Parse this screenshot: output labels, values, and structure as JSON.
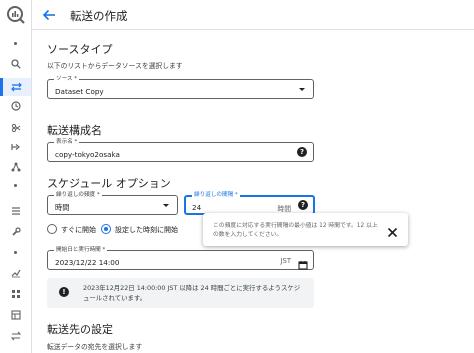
{
  "colors": {
    "accent": "#1a73e8",
    "active_bg": "#e8f0fe",
    "info_bg": "#f1f3f4"
  },
  "header": {
    "title": "転送の作成",
    "back_icon": "arrow-left-icon"
  },
  "rail": {
    "icons": [
      "bigquery-logo-icon",
      "search-icon",
      "transfers-icon",
      "scheduled-queries-icon",
      "analytics-hub-icon",
      "dataflow-icon",
      "graph-icon",
      "list-icon",
      "wrench-icon",
      "chart-icon",
      "grid-icon",
      "table-icon",
      "swap-icon"
    ],
    "active": "transfers-icon"
  },
  "source_type": {
    "title": "ソースタイプ",
    "description": "以下のリストからデータソースを選択します",
    "source_label": "ソース *",
    "source_value": "Dataset Copy"
  },
  "transfer_config": {
    "title": "転送構成名",
    "display_name_label": "表示名 *",
    "display_name_value": "copy-tokyo2osaka"
  },
  "schedule": {
    "title": "スケジュール オプション",
    "repeat_label": "繰り返しの頻度 *",
    "repeat_value": "時間",
    "interval_label": "繰り返しの間隔 *",
    "interval_value": "24",
    "interval_unit": "時間",
    "radio_now": "すぐに開始",
    "radio_set": "設定した時刻に開始",
    "radio_selected": "radio_set",
    "start_label": "開始日と実行時間 *",
    "start_value": "2023/12/22 14:00",
    "start_tz": "JST",
    "info_text": "2023年12月22日 14:00:00 JST 以降は 24 時間ごとに実行するようスケジュールされています。"
  },
  "tooltip": {
    "text": "この頻度に対応する実行間隔の最小値は 12 時間です。12 以上の数を入力してください。"
  },
  "destination": {
    "title": "転送先の設定",
    "description": "転送データの宛先を選択します"
  }
}
